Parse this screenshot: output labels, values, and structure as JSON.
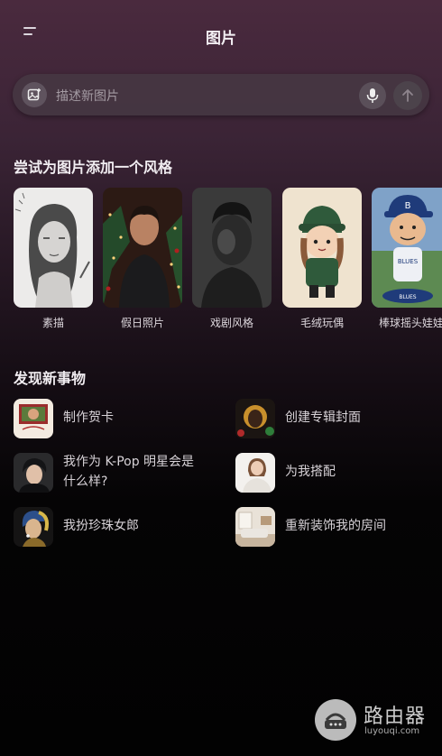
{
  "header": {
    "title": "图片",
    "menu_icon": "menu-icon"
  },
  "search": {
    "placeholder": "描述新图片",
    "image_icon": "image-add-icon",
    "mic_icon": "mic-icon",
    "send_icon": "arrow-up-icon"
  },
  "styles": {
    "title": "尝试为图片添加一个风格",
    "items": [
      {
        "label": "素描"
      },
      {
        "label": "假日照片"
      },
      {
        "label": "戏剧风格"
      },
      {
        "label": "毛绒玩偶"
      },
      {
        "label": "棒球摇头娃娃"
      }
    ]
  },
  "discover": {
    "title": "发现新事物",
    "items": [
      {
        "label": "制作贺卡"
      },
      {
        "label": "创建专辑封面"
      },
      {
        "label_line1": "我作为 K-Pop 明星会是",
        "label_line2": "什么样?"
      },
      {
        "label": "为我搭配"
      },
      {
        "label": "我扮珍珠女郎"
      },
      {
        "label": "重新装饰我的房间"
      }
    ]
  },
  "watermark": {
    "text": "路由器",
    "subtext": "luyouqi.com"
  }
}
